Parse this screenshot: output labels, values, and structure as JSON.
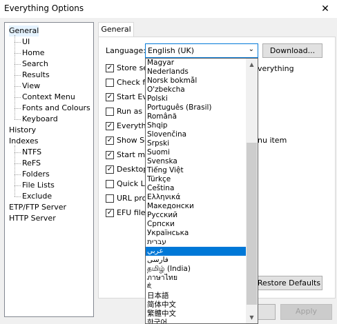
{
  "window": {
    "title": "Everything Options",
    "close": "✕"
  },
  "tree": {
    "items": [
      {
        "label": "General",
        "level": 0,
        "selected": true
      },
      {
        "label": "UI",
        "level": 1
      },
      {
        "label": "Home",
        "level": 1
      },
      {
        "label": "Search",
        "level": 1
      },
      {
        "label": "Results",
        "level": 1
      },
      {
        "label": "View",
        "level": 1
      },
      {
        "label": "Context Menu",
        "level": 1
      },
      {
        "label": "Fonts and Colours",
        "level": 1
      },
      {
        "label": "Keyboard",
        "level": 1
      },
      {
        "label": "History",
        "level": 0
      },
      {
        "label": "Indexes",
        "level": 0
      },
      {
        "label": "NTFS",
        "level": 1
      },
      {
        "label": "ReFS",
        "level": 1
      },
      {
        "label": "Folders",
        "level": 1
      },
      {
        "label": "File Lists",
        "level": 1
      },
      {
        "label": "Exclude",
        "level": 1
      },
      {
        "label": "ETP/FTP Server",
        "level": 0
      },
      {
        "label": "HTTP Server",
        "level": 0
      }
    ]
  },
  "tab": {
    "label": "General"
  },
  "language": {
    "label": "Language:",
    "selected": "English (UK)",
    "arrow": "⌄",
    "download_label": "Download..."
  },
  "checkboxes": [
    {
      "label": "Store se",
      "checked": true
    },
    {
      "label": "Check fo",
      "checked": false
    },
    {
      "label": "Start Eve",
      "checked": true
    },
    {
      "label": "Run as a",
      "checked": false
    },
    {
      "label": "Everythi",
      "checked": true
    },
    {
      "label": "Show Se",
      "checked": true
    },
    {
      "label": "Start me",
      "checked": true
    },
    {
      "label": "Desktop",
      "checked": true
    },
    {
      "label": "Quick La",
      "checked": false
    },
    {
      "label": "URL prot",
      "checked": false
    },
    {
      "label": "EFU file a",
      "checked": true
    }
  ],
  "partial_texts": {
    "store_tail": "verything",
    "show_tail": "nu item"
  },
  "dropdown": {
    "items": [
      "Magyar",
      "Nederlands",
      "Norsk bokmål",
      "O'zbekcha",
      "Polski",
      "Português (Brasil)",
      "Română",
      "Shqip",
      "Slovenčina",
      "Srpski",
      "Suomi",
      "Svenska",
      "Tiếng Việt",
      "Türkçe",
      "Čeština",
      "Ελληνικά",
      "Македонски",
      "Русский",
      "Српски",
      "Українська",
      "עברית",
      "عربي",
      "فارسی",
      "தமிழ் (India)",
      "ภาษาไทย",
      "ཇོ",
      "日本語",
      "简体中文",
      "繁體中文",
      "한국어"
    ],
    "highlighted_index": 21,
    "scroll_up": "▲",
    "scroll_down": "▼"
  },
  "buttons": {
    "restore_defaults": "Restore Defaults",
    "apply": "Apply"
  }
}
